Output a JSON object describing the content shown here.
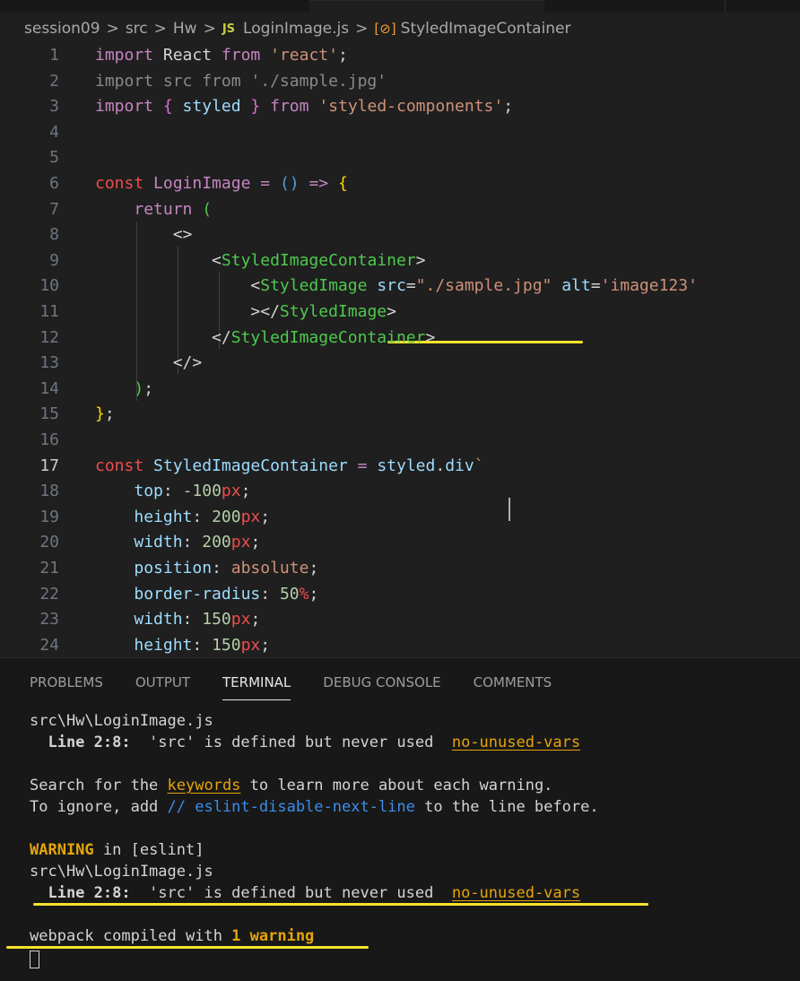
{
  "breadcrumb": {
    "items": [
      "session09",
      "src",
      "Hw"
    ],
    "file_badge": "JS",
    "file": "LoginImage.js",
    "symbol": "StyledImageContainer",
    "separator": ">",
    "file_icon": "javascript-icon",
    "symbol_icon": "symbol-variable-icon"
  },
  "editor": {
    "current_line": "17",
    "lines": [
      {
        "num": "1",
        "tokens": [
          {
            "t": "import",
            "c": "#c586c0"
          },
          {
            "t": " React ",
            "c": "#d4d4d4"
          },
          {
            "t": "from",
            "c": "#c586c0"
          },
          {
            "t": " ",
            "c": "#d4d4d4"
          },
          {
            "t": "'react'",
            "c": "#ce9178"
          },
          {
            "t": ";",
            "c": "#d4d4d4"
          }
        ]
      },
      {
        "num": "2",
        "tokens": [
          {
            "t": "import src from './sample.jpg'",
            "c": "#8a8a8a"
          }
        ]
      },
      {
        "num": "3",
        "tokens": [
          {
            "t": "import",
            "c": "#c586c0"
          },
          {
            "t": " ",
            "c": "#d4d4d4"
          },
          {
            "t": "{",
            "c": "#da70d6"
          },
          {
            "t": " styled ",
            "c": "#9cdcfe"
          },
          {
            "t": "}",
            "c": "#da70d6"
          },
          {
            "t": " ",
            "c": "#d4d4d4"
          },
          {
            "t": "from",
            "c": "#c586c0"
          },
          {
            "t": " ",
            "c": "#d4d4d4"
          },
          {
            "t": "'styled-components'",
            "c": "#ce9178"
          },
          {
            "t": ";",
            "c": "#d4d4d4"
          }
        ]
      },
      {
        "num": "4",
        "tokens": []
      },
      {
        "num": "5",
        "tokens": []
      },
      {
        "num": "6",
        "tokens": [
          {
            "t": "const",
            "c": "#f14c4c"
          },
          {
            "t": " ",
            "c": "#d4d4d4"
          },
          {
            "t": "LoginImage",
            "c": "#c586c0"
          },
          {
            "t": " ",
            "c": "#d4d4d4"
          },
          {
            "t": "=",
            "c": "#c586c0"
          },
          {
            "t": " ",
            "c": "#d4d4d4"
          },
          {
            "t": "()",
            "c": "#569cd6"
          },
          {
            "t": " ",
            "c": "#d4d4d4"
          },
          {
            "t": "=>",
            "c": "#c586c0"
          },
          {
            "t": " ",
            "c": "#d4d4d4"
          },
          {
            "t": "{",
            "c": "#ffd700"
          }
        ]
      },
      {
        "num": "7",
        "tokens": [
          {
            "t": "    ",
            "c": "#d4d4d4"
          },
          {
            "t": "return",
            "c": "#c586c0"
          },
          {
            "t": " ",
            "c": "#d4d4d4"
          },
          {
            "t": "(",
            "c": "#4ec94e"
          }
        ]
      },
      {
        "num": "8",
        "tokens": [
          {
            "t": "        <>",
            "c": "#d4d4d4"
          }
        ]
      },
      {
        "num": "9",
        "tokens": [
          {
            "t": "            <",
            "c": "#d4d4d4"
          },
          {
            "t": "StyledImageContainer",
            "c": "#4ec94e"
          },
          {
            "t": ">",
            "c": "#d4d4d4"
          }
        ]
      },
      {
        "num": "10",
        "tokens": [
          {
            "t": "                <",
            "c": "#d4d4d4"
          },
          {
            "t": "StyledImage",
            "c": "#4ec94e"
          },
          {
            "t": " ",
            "c": "#d4d4d4"
          },
          {
            "t": "src",
            "c": "#9cdcfe"
          },
          {
            "t": "=",
            "c": "#d4d4d4"
          },
          {
            "t": "\"./sample.jpg\"",
            "c": "#ce9178"
          },
          {
            "t": " ",
            "c": "#d4d4d4"
          },
          {
            "t": "alt",
            "c": "#9cdcfe"
          },
          {
            "t": "=",
            "c": "#d4d4d4"
          },
          {
            "t": "'image123'",
            "c": "#ce9178"
          }
        ]
      },
      {
        "num": "11",
        "tokens": [
          {
            "t": "                ></",
            "c": "#d4d4d4"
          },
          {
            "t": "StyledImage",
            "c": "#4ec94e"
          },
          {
            "t": ">",
            "c": "#d4d4d4"
          }
        ]
      },
      {
        "num": "12",
        "tokens": [
          {
            "t": "            </",
            "c": "#d4d4d4"
          },
          {
            "t": "StyledImageContainer",
            "c": "#4ec94e"
          },
          {
            "t": ">",
            "c": "#d4d4d4"
          }
        ]
      },
      {
        "num": "13",
        "tokens": [
          {
            "t": "        </>",
            "c": "#d4d4d4"
          }
        ]
      },
      {
        "num": "14",
        "tokens": [
          {
            "t": "    ",
            "c": "#d4d4d4"
          },
          {
            "t": ")",
            "c": "#4ec94e"
          },
          {
            "t": ";",
            "c": "#d4d4d4"
          }
        ]
      },
      {
        "num": "15",
        "tokens": [
          {
            "t": "}",
            "c": "#ffd700"
          },
          {
            "t": ";",
            "c": "#d4d4d4"
          }
        ]
      },
      {
        "num": "16",
        "tokens": []
      },
      {
        "num": "17",
        "tokens": [
          {
            "t": "const",
            "c": "#f14c4c"
          },
          {
            "t": " ",
            "c": "#d4d4d4"
          },
          {
            "t": "StyledImageContainer",
            "c": "#9cdcfe"
          },
          {
            "t": " ",
            "c": "#d4d4d4"
          },
          {
            "t": "=",
            "c": "#c586c0"
          },
          {
            "t": " ",
            "c": "#d4d4d4"
          },
          {
            "t": "styled",
            "c": "#9cdcfe"
          },
          {
            "t": ".",
            "c": "#d4d4d4"
          },
          {
            "t": "div",
            "c": "#9cdcfe"
          },
          {
            "t": "`",
            "c": "#ce9178"
          }
        ]
      },
      {
        "num": "18",
        "tokens": [
          {
            "t": "    ",
            "c": "#d4d4d4"
          },
          {
            "t": "top",
            "c": "#9cdcfe"
          },
          {
            "t": ": ",
            "c": "#d4d4d4"
          },
          {
            "t": "-100",
            "c": "#b5cea8"
          },
          {
            "t": "px",
            "c": "#f14c4c"
          },
          {
            "t": ";",
            "c": "#d4d4d4"
          }
        ]
      },
      {
        "num": "19",
        "tokens": [
          {
            "t": "    ",
            "c": "#d4d4d4"
          },
          {
            "t": "height",
            "c": "#9cdcfe"
          },
          {
            "t": ": ",
            "c": "#d4d4d4"
          },
          {
            "t": "200",
            "c": "#b5cea8"
          },
          {
            "t": "px",
            "c": "#f14c4c"
          },
          {
            "t": ";",
            "c": "#d4d4d4"
          }
        ]
      },
      {
        "num": "20",
        "tokens": [
          {
            "t": "    ",
            "c": "#d4d4d4"
          },
          {
            "t": "width",
            "c": "#9cdcfe"
          },
          {
            "t": ": ",
            "c": "#d4d4d4"
          },
          {
            "t": "200",
            "c": "#b5cea8"
          },
          {
            "t": "px",
            "c": "#f14c4c"
          },
          {
            "t": ";",
            "c": "#d4d4d4"
          }
        ]
      },
      {
        "num": "21",
        "tokens": [
          {
            "t": "    ",
            "c": "#d4d4d4"
          },
          {
            "t": "position",
            "c": "#9cdcfe"
          },
          {
            "t": ": ",
            "c": "#d4d4d4"
          },
          {
            "t": "absolute",
            "c": "#ce9178"
          },
          {
            "t": ";",
            "c": "#d4d4d4"
          }
        ]
      },
      {
        "num": "22",
        "tokens": [
          {
            "t": "    ",
            "c": "#d4d4d4"
          },
          {
            "t": "border-radius",
            "c": "#9cdcfe"
          },
          {
            "t": ": ",
            "c": "#d4d4d4"
          },
          {
            "t": "50",
            "c": "#b5cea8"
          },
          {
            "t": "%",
            "c": "#f14c4c"
          },
          {
            "t": ";",
            "c": "#d4d4d4"
          }
        ]
      },
      {
        "num": "23",
        "tokens": [
          {
            "t": "    ",
            "c": "#d4d4d4"
          },
          {
            "t": "width",
            "c": "#9cdcfe"
          },
          {
            "t": ": ",
            "c": "#d4d4d4"
          },
          {
            "t": "150",
            "c": "#b5cea8"
          },
          {
            "t": "px",
            "c": "#f14c4c"
          },
          {
            "t": ";",
            "c": "#d4d4d4"
          }
        ]
      },
      {
        "num": "24",
        "tokens": [
          {
            "t": "    ",
            "c": "#d4d4d4"
          },
          {
            "t": "height",
            "c": "#9cdcfe"
          },
          {
            "t": ": ",
            "c": "#d4d4d4"
          },
          {
            "t": "150",
            "c": "#b5cea8"
          },
          {
            "t": "px",
            "c": "#f14c4c"
          },
          {
            "t": ";",
            "c": "#d4d4d4"
          }
        ]
      }
    ]
  },
  "panel": {
    "tabs": [
      "PROBLEMS",
      "OUTPUT",
      "TERMINAL",
      "DEBUG CONSOLE",
      "COMMENTS"
    ],
    "active_tab": "TERMINAL"
  },
  "terminal": {
    "lines": [
      {
        "tokens": [
          {
            "t": "src\\Hw\\LoginImage.js",
            "c": "#d4d4d4"
          }
        ]
      },
      {
        "tokens": [
          {
            "t": "  Line 2:8:",
            "c": "#d4d4d4",
            "b": true
          },
          {
            "t": "  'src' is defined but never used  ",
            "c": "#d4d4d4"
          },
          {
            "t": "no-unused-vars",
            "c": "#e5a50a",
            "u": true
          }
        ]
      },
      {
        "tokens": []
      },
      {
        "tokens": [
          {
            "t": "Search for the ",
            "c": "#d4d4d4"
          },
          {
            "t": "keywords",
            "c": "#e5a50a",
            "u": true
          },
          {
            "t": " to learn more about each warning.",
            "c": "#d4d4d4"
          }
        ]
      },
      {
        "tokens": [
          {
            "t": "To ignore, add ",
            "c": "#d4d4d4"
          },
          {
            "t": "// eslint-disable-next-line",
            "c": "#3b8eea"
          },
          {
            "t": " to the line before.",
            "c": "#d4d4d4"
          }
        ]
      },
      {
        "tokens": []
      },
      {
        "tokens": [
          {
            "t": "WARNING",
            "c": "#e5a50a",
            "b": true
          },
          {
            "t": " in [eslint]",
            "c": "#d4d4d4"
          }
        ]
      },
      {
        "tokens": [
          {
            "t": "src\\Hw\\LoginImage.js",
            "c": "#d4d4d4"
          }
        ]
      },
      {
        "tokens": [
          {
            "t": "  Line 2:8:",
            "c": "#d4d4d4",
            "b": true
          },
          {
            "t": "  'src' is defined but never used  ",
            "c": "#d4d4d4"
          },
          {
            "t": "no-unused-vars",
            "c": "#e5a50a",
            "u": true
          }
        ]
      },
      {
        "tokens": []
      },
      {
        "tokens": [
          {
            "t": "webpack compiled with ",
            "c": "#d4d4d4"
          },
          {
            "t": "1 warning",
            "c": "#e5a50a",
            "b": true
          }
        ]
      }
    ]
  }
}
